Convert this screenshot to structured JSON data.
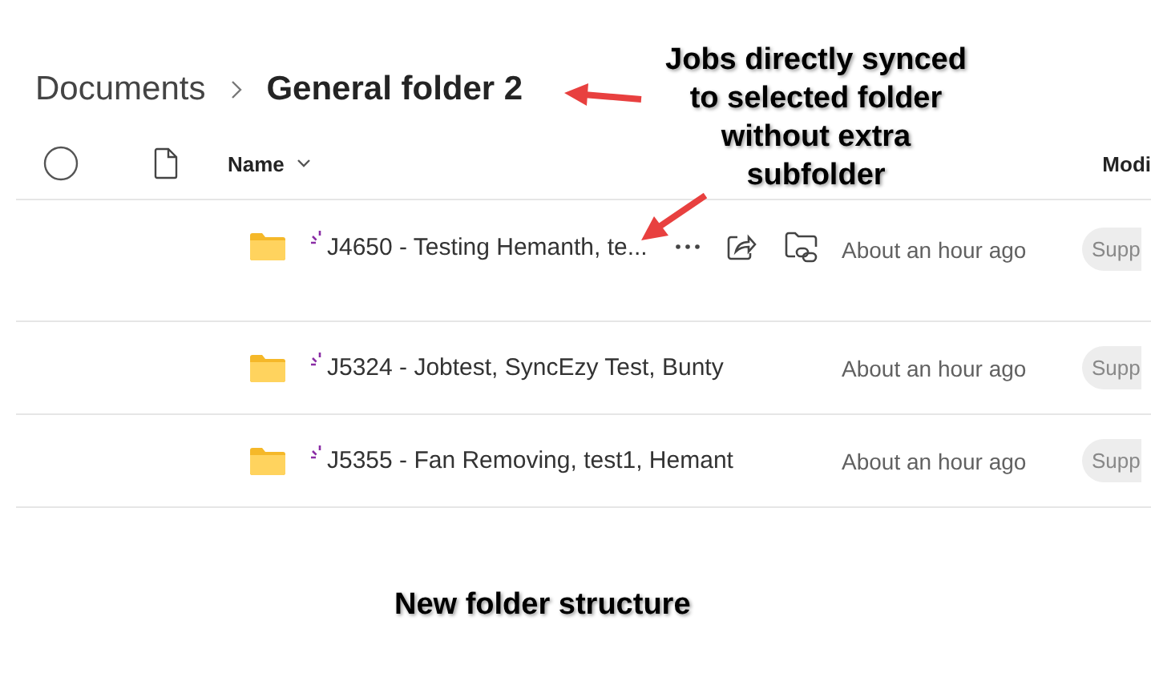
{
  "breadcrumb": [
    {
      "label": "Documents",
      "current": false
    },
    {
      "label": "General folder 2",
      "current": true
    }
  ],
  "table": {
    "all_selected": false,
    "columns": [
      {
        "kind": "select"
      },
      {
        "kind": "type"
      },
      {
        "kind": "name",
        "label": "Name"
      },
      {
        "kind": "modified",
        "label": "Modi"
      }
    ],
    "rows": [
      {
        "name": "J4650 - Testing Hemanth, te...",
        "new": true,
        "hovered": true,
        "modified": "About an hour ago",
        "modified_by": "Supp"
      },
      {
        "name": "J5324 - Jobtest, SyncEzy Test, Bunty",
        "new": true,
        "hovered": false,
        "modified": "About an hour ago",
        "modified_by": "Supp"
      },
      {
        "name": "J5355 - Fan Removing, test1, Hemant",
        "new": true,
        "hovered": false,
        "modified": "About an hour ago",
        "modified_by": "Supp"
      }
    ]
  },
  "annotation": "Jobs directly synced to selected folder without extra subfolder",
  "caption": "New folder structure"
}
